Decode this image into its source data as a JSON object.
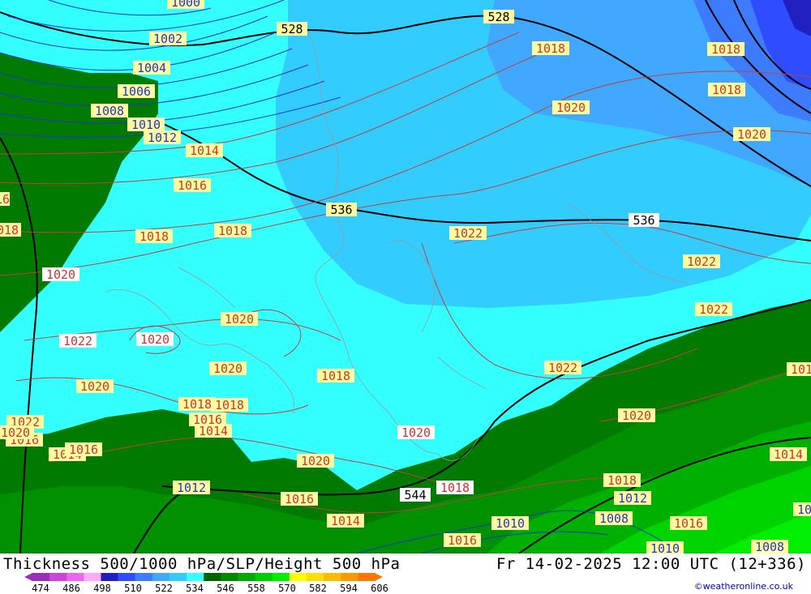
{
  "header": {
    "title": "Thickness 500/1000 hPa/SLP/Height 500 hPa",
    "datetime": "Fr 14-02-2025 12:00 UTC (12+336)",
    "credit": "©weatheronline.co.uk"
  },
  "legend": {
    "ticks": [
      "474",
      "486",
      "498",
      "510",
      "522",
      "534",
      "546",
      "558",
      "570",
      "582",
      "594",
      "606"
    ],
    "colors": [
      "#9b2fb8",
      "#cc44dd",
      "#ee66ee",
      "#ffaaff",
      "#2020c0",
      "#2f4cff",
      "#3d7cff",
      "#40a8ff",
      "#33ccff",
      "#33ffff",
      "#006400",
      "#008800",
      "#00aa00",
      "#00cc00",
      "#00ee00",
      "#ffff00",
      "#ffdd00",
      "#ffbb00",
      "#ff9900",
      "#ff7700"
    ]
  },
  "map_labels": {
    "thickness": [
      "528",
      "528",
      "536",
      "536",
      "544"
    ],
    "slp_blue": [
      "1000",
      "1002",
      "1004",
      "1006",
      "1008",
      "1010",
      "1012",
      "1012",
      "1012",
      "1010",
      "1008",
      "1010",
      "1008",
      "1010",
      "1012"
    ],
    "slp_red": [
      "1014",
      "1016",
      "1018",
      "1018",
      "1018",
      "1016",
      "1018",
      "1020",
      "1022",
      "1022",
      "1022",
      "1020",
      "1018",
      "1018",
      "1016",
      "1020",
      "1020",
      "1022",
      "1020",
      "1020",
      "1018",
      "1020",
      "1018",
      "1018",
      "1016",
      "1014",
      "1014",
      "1016",
      "1016",
      "1016",
      "1014",
      "1018",
      "1016",
      "1020",
      "1016",
      "1014",
      "1014",
      "1016",
      "1018",
      "1020",
      "1020",
      "1022",
      "1022",
      "1016",
      "1020",
      "1018",
      "1016",
      "1018",
      "1016",
      "1014",
      "1014",
      "1016"
    ]
  }
}
